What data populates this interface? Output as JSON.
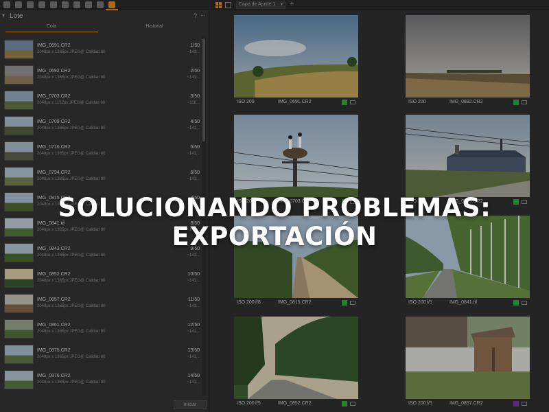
{
  "left_panel": {
    "title": "Lote",
    "help": "?",
    "menu": "···",
    "tabs": [
      "Cola",
      "Historial"
    ],
    "start_button": "Iniciar",
    "queue": [
      {
        "name": "IMG_0691.CR2",
        "detail": "2048px x 1365px JPEG@ Calidad 80",
        "count": "1/50",
        "size": "~141..."
      },
      {
        "name": "IMG_0692.CR2",
        "detail": "2048px x 1365px JPEG@ Calidad 80",
        "count": "2/50",
        "size": "~141..."
      },
      {
        "name": "IMG_0703.CR2",
        "detail": "2048px x 1152px JPEG@ Calidad 80",
        "count": "3/50",
        "size": "~116..."
      },
      {
        "name": "IMG_0709.CR2",
        "detail": "2048px x 1365px JPEG@ Calidad 80",
        "count": "4/50",
        "size": "~141..."
      },
      {
        "name": "IMG_0716.CR2",
        "detail": "2048px x 1365px JPEG@ Calidad 80",
        "count": "5/50",
        "size": "~141..."
      },
      {
        "name": "IMG_0794.CR2",
        "detail": "2048px x 1365px JPEG@ Calidad 80",
        "count": "6/50",
        "size": "~141..."
      },
      {
        "name": "IMG_0815.CR2",
        "detail": "2048px x 1365px JPEG@ Calidad 80",
        "count": "7/50",
        "size": "~141..."
      },
      {
        "name": "IMG_0841.tif",
        "detail": "2048px x 1365px JPEG@ Calidad 80",
        "count": "8/50",
        "size": "~141..."
      },
      {
        "name": "IMG_0843.CR2",
        "detail": "2048px x 1365px JPEG@ Calidad 80",
        "count": "9/50",
        "size": "~141..."
      },
      {
        "name": "IMG_0852.CR2",
        "detail": "2048px x 1365px JPEG@ Calidad 80",
        "count": "10/50",
        "size": "~141..."
      },
      {
        "name": "IMG_0857.CR2",
        "detail": "2048px x 1365px JPEG@ Calidad 80",
        "count": "11/50",
        "size": "~141..."
      },
      {
        "name": "IMG_0861.CR2",
        "detail": "2048px x 1365px JPEG@ Calidad 80",
        "count": "12/50",
        "size": "~141..."
      },
      {
        "name": "IMG_0875.CR2",
        "detail": "2048px x 1365px JPEG@ Calidad 80",
        "count": "13/50",
        "size": "~141..."
      },
      {
        "name": "IMG_0876.CR2",
        "detail": "2048px x 1365px JPEG@ Calidad 80",
        "count": "14/50",
        "size": "~141..."
      }
    ]
  },
  "toolbar": {
    "layer_select": "Capa de Ajuste 1",
    "add_layer": "+"
  },
  "browser": [
    {
      "iso": "ISO 200",
      "aperture": "",
      "name": "IMG_0691.CR2",
      "tag_color": "#2e9e3e"
    },
    {
      "iso": "ISO 200",
      "aperture": "",
      "name": "IMG_0692.CR2",
      "tag_color": "#2e9e3e"
    },
    {
      "iso": "ISO 200",
      "aperture": "",
      "name": "IMG_0703.CR2",
      "tag_color": "#2e9e3e"
    },
    {
      "iso": "ISO 200",
      "aperture": "",
      "name": "IMG_0709.CR2",
      "tag_color": "#2e9e3e"
    },
    {
      "iso": "ISO 200",
      "aperture": "f/8",
      "name": "IMG_0815.CR2",
      "tag_color": "#2e9e3e"
    },
    {
      "iso": "ISO 200",
      "aperture": "f/5",
      "name": "IMG_0841.tif",
      "tag_color": "#2e9e3e"
    },
    {
      "iso": "ISO 200",
      "aperture": "f/5",
      "name": "IMG_0852.CR2",
      "tag_color": "#2e9e3e"
    },
    {
      "iso": "ISO 200",
      "aperture": "f/5",
      "name": "IMG_0857.CR2",
      "tag_color": "#7a2fa0"
    }
  ],
  "overlay": {
    "line1": "SOLUCIONANDO PROBLEMAS:",
    "line2": "EXPORTACIÓN"
  },
  "colors": {
    "accent": "#d77f1f",
    "tag_green": "#2e9e3e",
    "tag_purple": "#7a2fa0"
  }
}
